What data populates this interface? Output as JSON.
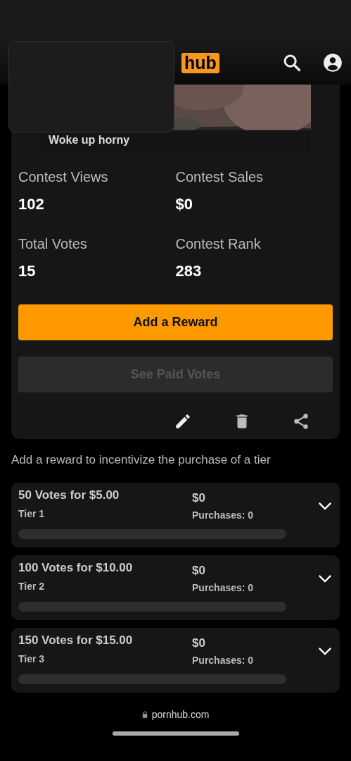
{
  "header": {
    "logo_badge": "hub"
  },
  "contest_entry": {
    "caption": "Woke up horny"
  },
  "stats": [
    {
      "label": "Contest Views",
      "value": "102"
    },
    {
      "label": "Contest Sales",
      "value": "$0"
    },
    {
      "label": "Total Votes",
      "value": "15"
    },
    {
      "label": "Contest Rank",
      "value": "283"
    }
  ],
  "buttons": [
    {
      "label": "Add a Reward",
      "kind": "primary",
      "disabled": false
    },
    {
      "label": "See Paid Votes",
      "kind": "secondary",
      "disabled": true
    }
  ],
  "hint": "Add a reward to incentivize the purchase of a tier",
  "tiers": [
    {
      "title": "50 Votes for $5.00",
      "tier": "Tier 1",
      "amount": "$0",
      "purchases": "Purchases: 0",
      "level": 0,
      "expanded": false
    },
    {
      "title": "100 Votes for $10.00",
      "tier": "Tier 2",
      "amount": "$0",
      "purchases": "Purchases: 0",
      "level": 0,
      "expanded": false
    },
    {
      "title": "150 Votes for $15.00",
      "tier": "Tier 3",
      "amount": "$0",
      "purchases": "Purchases: 0",
      "level": 0,
      "expanded": false
    }
  ],
  "address_bar": {
    "url": "pornhub.com"
  }
}
